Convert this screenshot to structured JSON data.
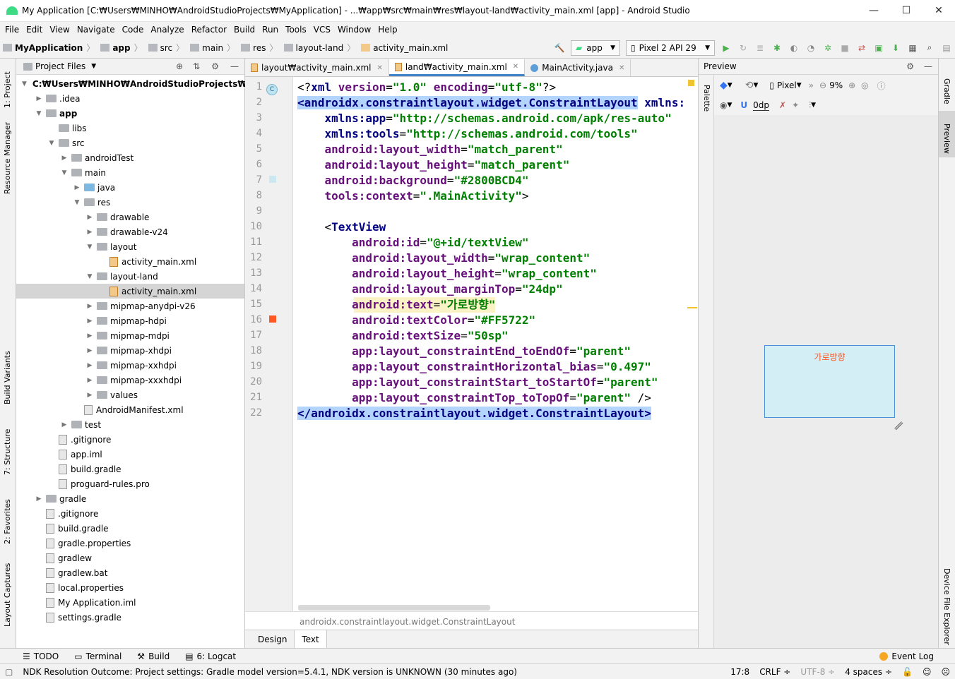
{
  "window": {
    "title": "My Application [C:₩Users₩MINHO₩AndroidStudioProjects₩MyApplication] - ...₩app₩src₩main₩res₩layout-land₩activity_main.xml [app] - Android Studio"
  },
  "menu": [
    "File",
    "Edit",
    "View",
    "Navigate",
    "Code",
    "Analyze",
    "Refactor",
    "Build",
    "Run",
    "Tools",
    "VCS",
    "Window",
    "Help"
  ],
  "breadcrumb": [
    "MyApplication",
    "app",
    "src",
    "main",
    "res",
    "layout-land",
    "activity_main.xml"
  ],
  "toolbar": {
    "run_config": "app",
    "device": "Pixel 2 API 29"
  },
  "project_panel": {
    "title": "Project Files",
    "items": [
      {
        "label": "C:₩Users₩MINHO₩AndroidStudioProjects₩MyAp",
        "depth": 0,
        "kind": "folder",
        "arrow": "▼"
      },
      {
        "label": ".idea",
        "depth": 1,
        "kind": "folder",
        "arrow": "▶"
      },
      {
        "label": "app",
        "depth": 1,
        "kind": "folder",
        "arrow": "▼"
      },
      {
        "label": "libs",
        "depth": 2,
        "kind": "folder",
        "arrow": ""
      },
      {
        "label": "src",
        "depth": 2,
        "kind": "folder",
        "arrow": "▼"
      },
      {
        "label": "androidTest",
        "depth": 3,
        "kind": "folder",
        "arrow": "▶"
      },
      {
        "label": "main",
        "depth": 3,
        "kind": "folder",
        "arrow": "▼"
      },
      {
        "label": "java",
        "depth": 4,
        "kind": "folder-blue",
        "arrow": "▶"
      },
      {
        "label": "res",
        "depth": 4,
        "kind": "folder",
        "arrow": "▼"
      },
      {
        "label": "drawable",
        "depth": 5,
        "kind": "folder",
        "arrow": "▶"
      },
      {
        "label": "drawable-v24",
        "depth": 5,
        "kind": "folder",
        "arrow": "▶"
      },
      {
        "label": "layout",
        "depth": 5,
        "kind": "folder",
        "arrow": "▼"
      },
      {
        "label": "activity_main.xml",
        "depth": 6,
        "kind": "xml",
        "arrow": ""
      },
      {
        "label": "layout-land",
        "depth": 5,
        "kind": "folder",
        "arrow": "▼"
      },
      {
        "label": "activity_main.xml",
        "depth": 6,
        "kind": "xml",
        "arrow": "",
        "selected": true
      },
      {
        "label": "mipmap-anydpi-v26",
        "depth": 5,
        "kind": "folder",
        "arrow": "▶"
      },
      {
        "label": "mipmap-hdpi",
        "depth": 5,
        "kind": "folder",
        "arrow": "▶"
      },
      {
        "label": "mipmap-mdpi",
        "depth": 5,
        "kind": "folder",
        "arrow": "▶"
      },
      {
        "label": "mipmap-xhdpi",
        "depth": 5,
        "kind": "folder",
        "arrow": "▶"
      },
      {
        "label": "mipmap-xxhdpi",
        "depth": 5,
        "kind": "folder",
        "arrow": "▶"
      },
      {
        "label": "mipmap-xxxhdpi",
        "depth": 5,
        "kind": "folder",
        "arrow": "▶"
      },
      {
        "label": "values",
        "depth": 5,
        "kind": "folder",
        "arrow": "▶"
      },
      {
        "label": "AndroidManifest.xml",
        "depth": 4,
        "kind": "file",
        "arrow": ""
      },
      {
        "label": "test",
        "depth": 3,
        "kind": "folder",
        "arrow": "▶"
      },
      {
        "label": ".gitignore",
        "depth": 2,
        "kind": "file",
        "arrow": ""
      },
      {
        "label": "app.iml",
        "depth": 2,
        "kind": "file",
        "arrow": ""
      },
      {
        "label": "build.gradle",
        "depth": 2,
        "kind": "file",
        "arrow": ""
      },
      {
        "label": "proguard-rules.pro",
        "depth": 2,
        "kind": "file",
        "arrow": ""
      },
      {
        "label": "gradle",
        "depth": 1,
        "kind": "folder",
        "arrow": "▶"
      },
      {
        "label": ".gitignore",
        "depth": 1,
        "kind": "file",
        "arrow": ""
      },
      {
        "label": "build.gradle",
        "depth": 1,
        "kind": "file",
        "arrow": ""
      },
      {
        "label": "gradle.properties",
        "depth": 1,
        "kind": "file",
        "arrow": ""
      },
      {
        "label": "gradlew",
        "depth": 1,
        "kind": "file",
        "arrow": ""
      },
      {
        "label": "gradlew.bat",
        "depth": 1,
        "kind": "file",
        "arrow": ""
      },
      {
        "label": "local.properties",
        "depth": 1,
        "kind": "file",
        "arrow": ""
      },
      {
        "label": "My Application.iml",
        "depth": 1,
        "kind": "file",
        "arrow": ""
      },
      {
        "label": "settings.gradle",
        "depth": 1,
        "kind": "file",
        "arrow": ""
      }
    ]
  },
  "left_strip": [
    "1: Project",
    "Resource Manager",
    "Build Variants",
    "7: Structure",
    "2: Favorites",
    "Layout Captures"
  ],
  "right_strip": [
    "Gradle",
    "Preview",
    "Device File Explorer"
  ],
  "editor": {
    "tabs": [
      {
        "label": "layout₩activity_main.xml",
        "active": false
      },
      {
        "label": "land₩activity_main.xml",
        "active": true
      },
      {
        "label": "MainActivity.java",
        "active": false
      }
    ],
    "lines": [
      [
        [
          "p",
          "<?"
        ],
        [
          "t",
          "xml "
        ],
        [
          "a",
          "version"
        ],
        [
          "p",
          "="
        ],
        [
          "v",
          "\"1.0\""
        ],
        [
          "p",
          " "
        ],
        [
          "a",
          "encoding"
        ],
        [
          "p",
          "="
        ],
        [
          "v",
          "\"utf-8\""
        ],
        [
          "p",
          "?>"
        ]
      ],
      [
        [
          "h",
          "<androidx.constraintlayout.widget.ConstraintLayout"
        ],
        [
          "p",
          " "
        ],
        [
          "t",
          "xmlns:"
        ]
      ],
      [
        [
          "p",
          "    "
        ],
        [
          "n",
          "xmlns:app"
        ],
        [
          "p",
          "="
        ],
        [
          "v",
          "\"http://schemas.android.com/apk/res-auto\""
        ]
      ],
      [
        [
          "p",
          "    "
        ],
        [
          "n",
          "xmlns:tools"
        ],
        [
          "p",
          "="
        ],
        [
          "v",
          "\"http://schemas.android.com/tools\""
        ]
      ],
      [
        [
          "p",
          "    "
        ],
        [
          "a",
          "android:layout_width"
        ],
        [
          "p",
          "="
        ],
        [
          "v",
          "\"match_parent\""
        ]
      ],
      [
        [
          "p",
          "    "
        ],
        [
          "a",
          "android:layout_height"
        ],
        [
          "p",
          "="
        ],
        [
          "v",
          "\"match_parent\""
        ]
      ],
      [
        [
          "p",
          "    "
        ],
        [
          "a",
          "android:background"
        ],
        [
          "p",
          "="
        ],
        [
          "v",
          "\"#2800BCD4\""
        ]
      ],
      [
        [
          "p",
          "    "
        ],
        [
          "a",
          "tools:context"
        ],
        [
          "p",
          "="
        ],
        [
          "v",
          "\".MainActivity\""
        ],
        [
          "p",
          ">"
        ]
      ],
      [
        [
          "p",
          ""
        ]
      ],
      [
        [
          "p",
          "    <"
        ],
        [
          "t",
          "TextView"
        ]
      ],
      [
        [
          "p",
          "        "
        ],
        [
          "a",
          "android:id"
        ],
        [
          "p",
          "="
        ],
        [
          "v",
          "\"@+id/textView\""
        ]
      ],
      [
        [
          "p",
          "        "
        ],
        [
          "a",
          "android:layout_width"
        ],
        [
          "p",
          "="
        ],
        [
          "v",
          "\"wrap_content\""
        ]
      ],
      [
        [
          "p",
          "        "
        ],
        [
          "a",
          "android:layout_height"
        ],
        [
          "p",
          "="
        ],
        [
          "v",
          "\"wrap_content\""
        ]
      ],
      [
        [
          "p",
          "        "
        ],
        [
          "a",
          "android:layout_marginTop"
        ],
        [
          "p",
          "="
        ],
        [
          "v",
          "\"24dp\""
        ]
      ],
      [
        [
          "p",
          "        "
        ],
        [
          "a",
          "android:text"
        ],
        [
          "p",
          "="
        ],
        [
          "v",
          "\"가로방향\""
        ]
      ],
      [
        [
          "p",
          "        "
        ],
        [
          "a",
          "android:textColor"
        ],
        [
          "p",
          "="
        ],
        [
          "v",
          "\"#FF5722\""
        ]
      ],
      [
        [
          "p",
          "        "
        ],
        [
          "a",
          "android:textSize"
        ],
        [
          "p",
          "="
        ],
        [
          "v",
          "\"50sp\""
        ]
      ],
      [
        [
          "p",
          "        "
        ],
        [
          "a",
          "app:layout_constraintEnd_toEndOf"
        ],
        [
          "p",
          "="
        ],
        [
          "v",
          "\"parent\""
        ]
      ],
      [
        [
          "p",
          "        "
        ],
        [
          "a",
          "app:layout_constraintHorizontal_bias"
        ],
        [
          "p",
          "="
        ],
        [
          "v",
          "\"0.497\""
        ]
      ],
      [
        [
          "p",
          "        "
        ],
        [
          "a",
          "app:layout_constraintStart_toStartOf"
        ],
        [
          "p",
          "="
        ],
        [
          "v",
          "\"parent\""
        ]
      ],
      [
        [
          "p",
          "        "
        ],
        [
          "a",
          "app:layout_constraintTop_toTopOf"
        ],
        [
          "p",
          "="
        ],
        [
          "v",
          "\"parent\""
        ],
        [
          "p",
          " />"
        ]
      ],
      [
        [
          "h",
          "</androidx.constraintlayout.widget.ConstraintLayout>"
        ]
      ]
    ],
    "context_path": "androidx.constraintlayout.widget.ConstraintLayout",
    "bottom_tabs": [
      "Design",
      "Text"
    ]
  },
  "preview": {
    "title": "Preview",
    "palette_label": "Palette",
    "device": "Pixel",
    "zoom": "9%",
    "margin": "0dp",
    "textview_text": "가로방향",
    "colors": {
      "text": "#FF5722",
      "background": "#D3EEF5"
    }
  },
  "tool_windows": [
    "TODO",
    "Terminal",
    "Build",
    "6: Logcat"
  ],
  "event_log": "Event Log",
  "status": {
    "message": "NDK Resolution Outcome: Project settings: Gradle model version=5.4.1, NDK version is UNKNOWN (30 minutes ago)",
    "position": "17:8",
    "line_sep": "CRLF ÷",
    "encoding": "UTF-8 ÷",
    "indent": "4 spaces ÷"
  }
}
